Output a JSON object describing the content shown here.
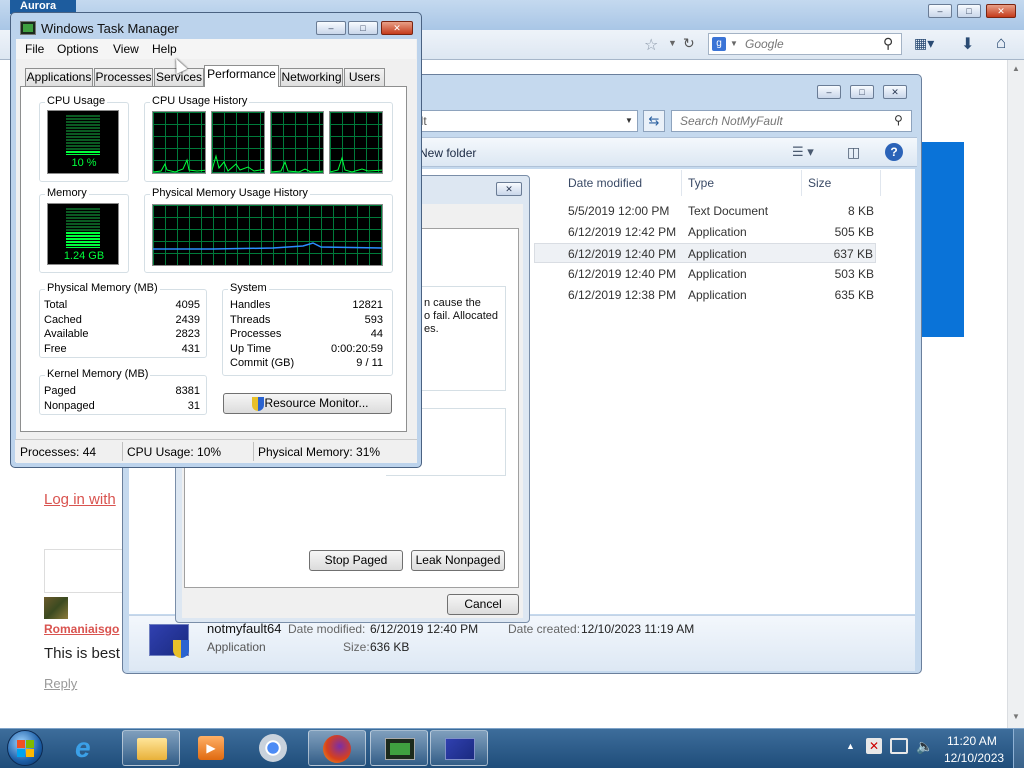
{
  "browser": {
    "tab_label": "Aurora",
    "search_placeholder": "Google",
    "login_link": "Log in with",
    "comment_user": "Romaniaisgo",
    "comment_text": "This is best",
    "reply_link": "Reply"
  },
  "explorer": {
    "address_text": "ult",
    "search_placeholder": "Search NotMyFault",
    "new_folder": "New folder",
    "columns": [
      "Date modified",
      "Type",
      "Size"
    ],
    "files": [
      {
        "date": "5/5/2019 12:00 PM",
        "type": "Text Document",
        "size": "8 KB"
      },
      {
        "date": "6/12/2019 12:42 PM",
        "type": "Application",
        "size": "505 KB"
      },
      {
        "date": "6/12/2019 12:40 PM",
        "type": "Application",
        "size": "637 KB"
      },
      {
        "date": "6/12/2019 12:40 PM",
        "type": "Application",
        "size": "503 KB"
      },
      {
        "date": "6/12/2019 12:38 PM",
        "type": "Application",
        "size": "635 KB"
      }
    ],
    "details": {
      "name": "notmyfault64",
      "modified_label": "Date modified:",
      "modified_value": "6/12/2019 12:40 PM",
      "created_label": "Date created:",
      "created_value": "12/10/2023 11:19 AM",
      "type": "Application",
      "size_label": "Size:",
      "size_value": "636 KB"
    }
  },
  "dialog": {
    "text_line1": "n cause the",
    "text_line2": "o fail. Allocated",
    "text_line3": "es.",
    "stop_paged": "Stop Paged",
    "leak_nonpaged": "Leak Nonpaged",
    "cancel": "Cancel"
  },
  "taskmgr": {
    "title": "Windows Task Manager",
    "menu": [
      "File",
      "Options",
      "View",
      "Help"
    ],
    "tabs": [
      "Applications",
      "Processes",
      "Services",
      "Performance",
      "Networking",
      "Users"
    ],
    "cpu_usage_title": "CPU Usage",
    "cpu_usage_value": "10 %",
    "cpu_history_title": "CPU Usage History",
    "memory_title": "Memory",
    "memory_value": "1.24 GB",
    "mem_history_title": "Physical Memory Usage History",
    "physical_memory": {
      "title": "Physical Memory (MB)",
      "rows": [
        {
          "label": "Total",
          "value": "4095"
        },
        {
          "label": "Cached",
          "value": "2439"
        },
        {
          "label": "Available",
          "value": "2823"
        },
        {
          "label": "Free",
          "value": "431"
        }
      ]
    },
    "kernel_memory": {
      "title": "Kernel Memory (MB)",
      "rows": [
        {
          "label": "Paged",
          "value": "8381"
        },
        {
          "label": "Nonpaged",
          "value": "31"
        }
      ]
    },
    "system": {
      "title": "System",
      "rows": [
        {
          "label": "Handles",
          "value": "12821"
        },
        {
          "label": "Threads",
          "value": "593"
        },
        {
          "label": "Processes",
          "value": "44"
        },
        {
          "label": "Up Time",
          "value": "0:00:20:59"
        },
        {
          "label": "Commit (GB)",
          "value": "9 / 11"
        }
      ]
    },
    "resource_monitor_button": "Resource Monitor...",
    "status": {
      "processes": "Processes: 44",
      "cpu": "CPU Usage: 10%",
      "memory": "Physical Memory: 31%"
    }
  },
  "taskbar": {
    "time": "11:20 AM",
    "date": "12/10/2023"
  },
  "colors": {
    "graph_green": "#00ff3c",
    "grid_green": "#007a3a",
    "memory_line": "#2b8cff",
    "taskbar": "#1f4d7a",
    "win_frame": "#b9d1ea"
  }
}
